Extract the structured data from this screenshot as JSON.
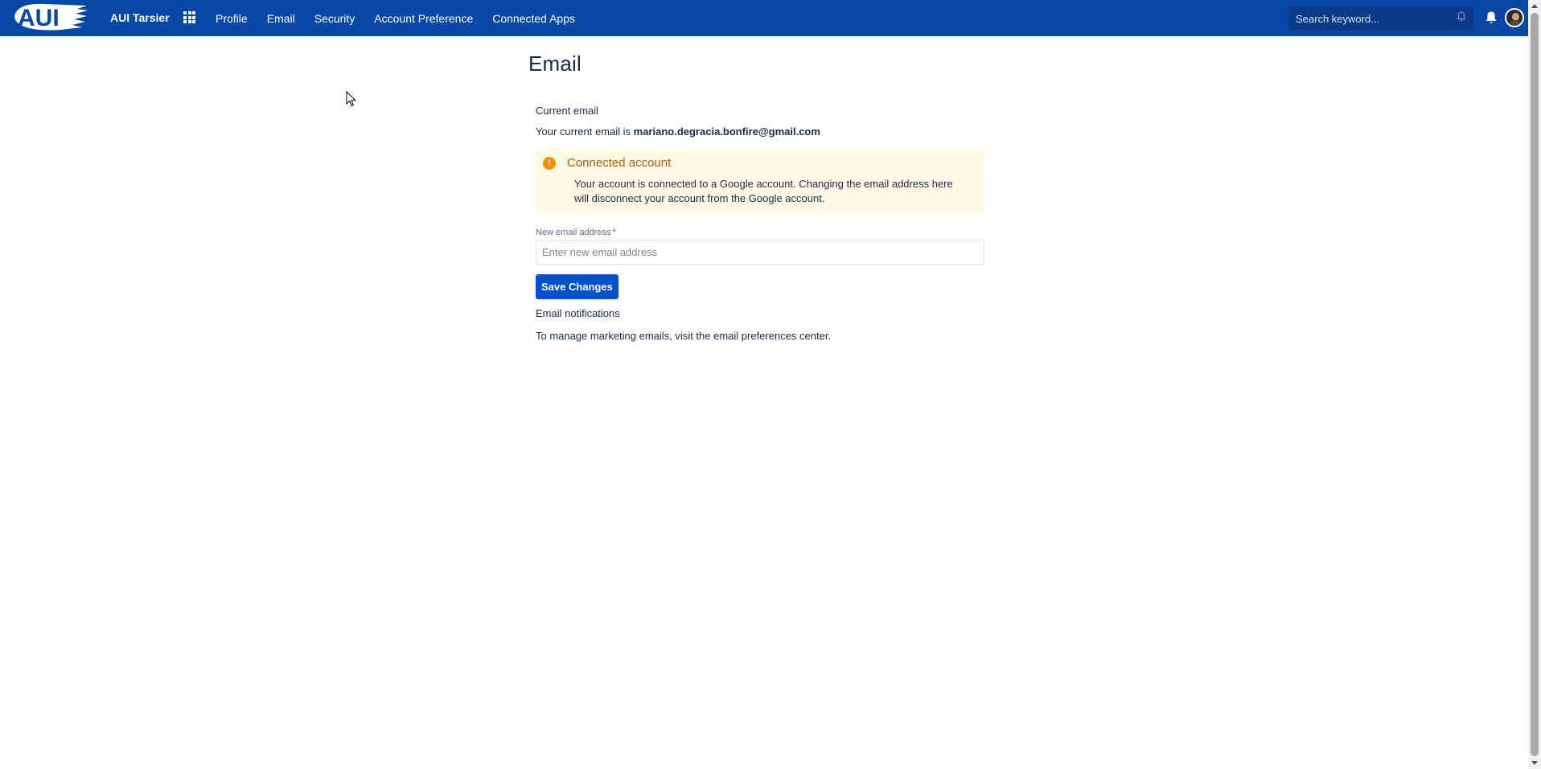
{
  "header": {
    "logo_text": "AUI",
    "app_name": "AUI Tarsier",
    "nav_items": [
      {
        "label": "Profile"
      },
      {
        "label": "Email"
      },
      {
        "label": "Security"
      },
      {
        "label": "Account Preference"
      },
      {
        "label": "Connected Apps"
      }
    ],
    "search": {
      "placeholder": "Search keyword...",
      "value": ""
    },
    "icons": [
      "apps-grid-icon",
      "bell-icon",
      "avatar"
    ],
    "brand_color": "#0747a6"
  },
  "page": {
    "title": "Email",
    "current_email": {
      "heading": "Current email",
      "prefix": "Your current email is ",
      "address": "mariano.degracia.bonfire@gmail.com"
    },
    "warning": {
      "title": "Connected account",
      "body": "Your account is connected to a Google account. Changing the email address here will disconnect your account from the Google account.",
      "color": "#ff8b00"
    },
    "new_email": {
      "label": "New email address",
      "required_marker": "*",
      "placeholder": "Enter new email address",
      "value": ""
    },
    "save_button": "Save Changes",
    "notifications": {
      "heading": "Email notifications",
      "text": "To manage marketing emails, visit the email preferences center."
    }
  }
}
